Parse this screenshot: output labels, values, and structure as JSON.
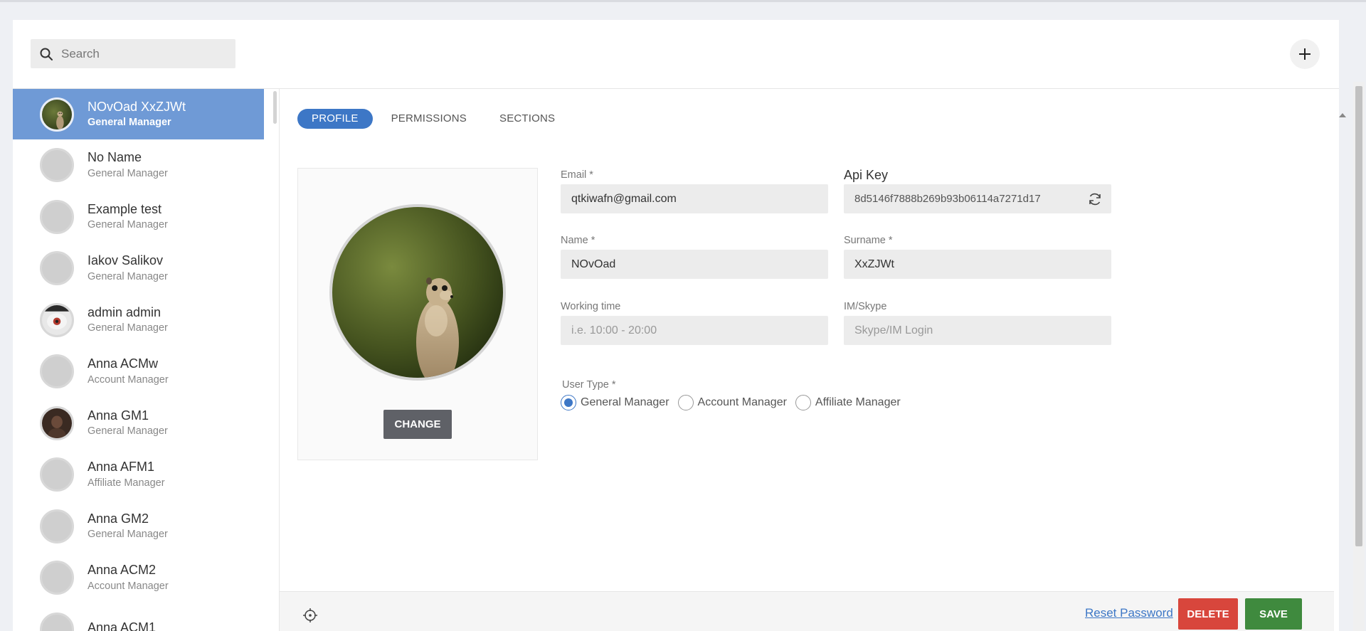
{
  "search": {
    "placeholder": "Search"
  },
  "users": [
    {
      "name": "NOvOad XxZJWt",
      "role": "General Manager",
      "active": true,
      "avatar": "meerkat"
    },
    {
      "name": "No Name",
      "role": "General Manager",
      "avatar": "placeholder"
    },
    {
      "name": "Example test",
      "role": "General Manager",
      "avatar": "placeholder"
    },
    {
      "name": "Iakov Salikov",
      "role": "General Manager",
      "avatar": "placeholder"
    },
    {
      "name": "admin admin",
      "role": "General Manager",
      "avatar": "photo"
    },
    {
      "name": "Anna ACMw",
      "role": "Account Manager",
      "avatar": "placeholder"
    },
    {
      "name": "Anna GM1",
      "role": "General Manager",
      "avatar": "photo-dark"
    },
    {
      "name": "Anna AFM1",
      "role": "Affiliate Manager",
      "avatar": "placeholder"
    },
    {
      "name": "Anna GM2",
      "role": "General Manager",
      "avatar": "placeholder"
    },
    {
      "name": "Anna ACM2",
      "role": "Account Manager",
      "avatar": "placeholder"
    },
    {
      "name": "Anna ACM1",
      "role": "",
      "avatar": "placeholder"
    }
  ],
  "tabs": {
    "profile": "PROFILE",
    "permissions": "PERMISSIONS",
    "sections": "SECTIONS"
  },
  "photo": {
    "change_label": "CHANGE"
  },
  "form": {
    "email": {
      "label": "Email *",
      "value": "qtkiwafn@gmail.com"
    },
    "api_key": {
      "label": "Api Key",
      "value": "8d5146f7888b269b93b06114a7271d17"
    },
    "name": {
      "label": "Name *",
      "value": "NOvOad"
    },
    "surname": {
      "label": "Surname *",
      "value": "XxZJWt"
    },
    "working_time": {
      "label": "Working time",
      "placeholder": "i.e. 10:00 - 20:00"
    },
    "im_skype": {
      "label": "IM/Skype",
      "placeholder": "Skype/IM Login"
    },
    "user_type": {
      "label": "User Type *",
      "options": [
        "General Manager",
        "Account Manager",
        "Affiliate Manager"
      ],
      "selected": "General Manager"
    }
  },
  "footer": {
    "reset_password": "Reset Password",
    "delete": "DELETE",
    "save": "SAVE"
  },
  "colors": {
    "accent": "#3d77c6",
    "active_row": "#6f9ad6",
    "delete": "#d8463c",
    "save": "#3f8a3e"
  }
}
